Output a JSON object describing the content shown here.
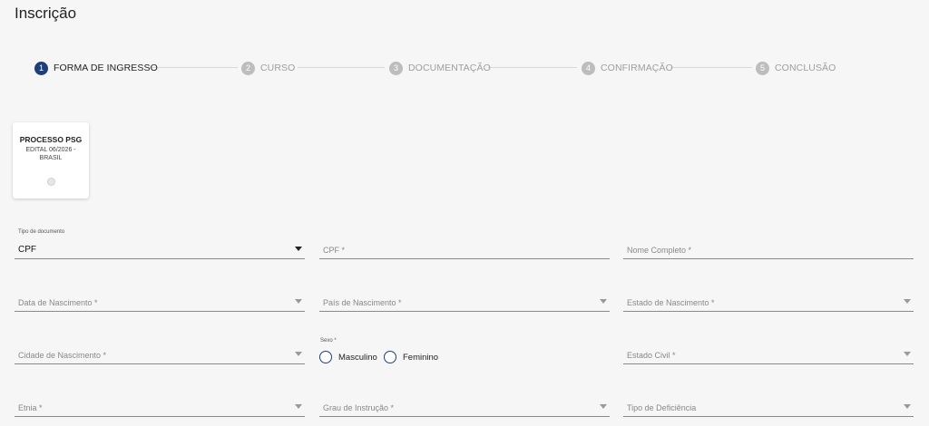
{
  "page": {
    "title": "Inscrição"
  },
  "stepper": {
    "steps": [
      {
        "num": "1",
        "label": "FORMA DE INGRESSO"
      },
      {
        "num": "2",
        "label": "CURSO"
      },
      {
        "num": "3",
        "label": "DOCUMENTAÇÃO"
      },
      {
        "num": "4",
        "label": "CONFIRMAÇÃO"
      },
      {
        "num": "5",
        "label": "CONCLUSÃO"
      }
    ],
    "active_step": 1
  },
  "card": {
    "title": "PROCESSO PSG",
    "subtitle": "EDITAL 06/2026 - BRASIL"
  },
  "form": {
    "tipo_documento": {
      "label": "Tipo de documento",
      "value": "CPF"
    },
    "cpf": {
      "placeholder": "CPF *"
    },
    "nome_completo": {
      "placeholder": "Nome Completo *"
    },
    "data_nascimento": {
      "placeholder": "Data de Nascimento *"
    },
    "pais_nascimento": {
      "placeholder": "País de Nascimento *"
    },
    "estado_nascimento": {
      "placeholder": "Estado de Nascimento *"
    },
    "cidade_nascimento": {
      "placeholder": "Cidade de Nascimento *"
    },
    "sexo": {
      "label": "Sexo *",
      "options": [
        "Masculino",
        "Feminino"
      ]
    },
    "estado_civil": {
      "placeholder": "Estado Civil *"
    },
    "etnia": {
      "placeholder": "Etnia *"
    },
    "grau_instrucao": {
      "placeholder": "Grau de Instrução *"
    },
    "tipo_deficiencia": {
      "placeholder": "Tipo de Deficiência"
    }
  },
  "colors": {
    "primary": "#1f3f7a",
    "inactive": "#bdbdbd",
    "background": "#f6f6f6"
  }
}
